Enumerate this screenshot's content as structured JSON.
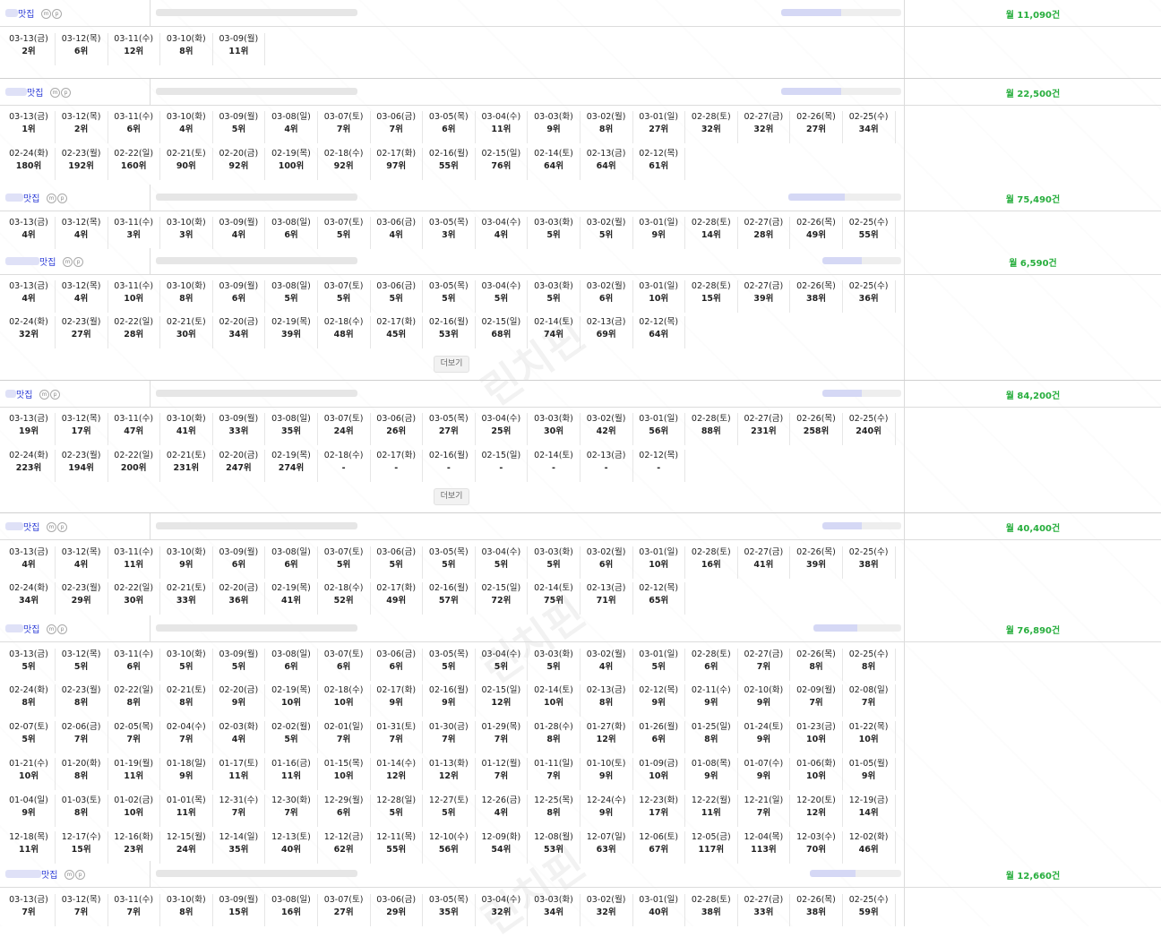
{
  "keyword_suffix": "맛집",
  "mp_badges": [
    "m",
    "p"
  ],
  "more_label": "더보기",
  "colors": {
    "name": "#2b3bd6",
    "volume": "#27ae3d"
  },
  "rows": [
    {
      "volume": "월 11,090건",
      "groups": [
        {
          "dates": [
            "03-13(금)",
            "03-12(목)",
            "03-11(수)",
            "03-10(화)",
            "03-09(월)"
          ],
          "ranks": [
            "2위",
            "6위",
            "12위",
            "8위",
            "11위"
          ]
        }
      ]
    },
    {
      "volume": "월 22,500건",
      "groups": [
        {
          "dates": [
            "03-13(금)",
            "03-12(목)",
            "03-11(수)",
            "03-10(화)",
            "03-09(월)",
            "03-08(일)",
            "03-07(토)",
            "03-06(금)",
            "03-05(목)",
            "03-04(수)",
            "03-03(화)",
            "03-02(월)",
            "03-01(일)",
            "02-28(토)",
            "02-27(금)",
            "02-26(목)",
            "02-25(수)"
          ],
          "ranks": [
            "1위",
            "2위",
            "6위",
            "4위",
            "5위",
            "4위",
            "7위",
            "7위",
            "6위",
            "11위",
            "9위",
            "8위",
            "27위",
            "32위",
            "32위",
            "27위",
            "34위"
          ]
        },
        {
          "dates": [
            "02-24(화)",
            "02-23(월)",
            "02-22(일)",
            "02-21(토)",
            "02-20(금)",
            "02-19(목)",
            "02-18(수)",
            "02-17(화)",
            "02-16(월)",
            "02-15(일)",
            "02-14(토)",
            "02-13(금)",
            "02-12(목)"
          ],
          "ranks": [
            "180위",
            "192위",
            "160위",
            "90위",
            "92위",
            "100위",
            "92위",
            "97위",
            "55위",
            "76위",
            "64위",
            "64위",
            "61위"
          ]
        }
      ]
    },
    {
      "volume": "월 75,490건",
      "groups": [
        {
          "dates": [
            "03-13(금)",
            "03-12(목)",
            "03-11(수)",
            "03-10(화)",
            "03-09(월)",
            "03-08(일)",
            "03-07(토)",
            "03-06(금)",
            "03-05(목)",
            "03-04(수)",
            "03-03(화)",
            "03-02(월)",
            "03-01(일)",
            "02-28(토)",
            "02-27(금)",
            "02-26(목)",
            "02-25(수)"
          ],
          "ranks": [
            "4위",
            "4위",
            "3위",
            "3위",
            "4위",
            "6위",
            "5위",
            "4위",
            "3위",
            "4위",
            "5위",
            "5위",
            "9위",
            "14위",
            "28위",
            "49위",
            "55위"
          ]
        }
      ]
    },
    {
      "volume": "월 6,590건",
      "groups": [
        {
          "dates": [
            "03-13(금)",
            "03-12(목)",
            "03-11(수)",
            "03-10(화)",
            "03-09(월)",
            "03-08(일)",
            "03-07(토)",
            "03-06(금)",
            "03-05(목)",
            "03-04(수)",
            "03-03(화)",
            "03-02(월)",
            "03-01(일)",
            "02-28(토)",
            "02-27(금)",
            "02-26(목)",
            "02-25(수)"
          ],
          "ranks": [
            "4위",
            "4위",
            "10위",
            "8위",
            "6위",
            "5위",
            "5위",
            "5위",
            "5위",
            "5위",
            "5위",
            "6위",
            "10위",
            "15위",
            "39위",
            "38위",
            "36위"
          ]
        },
        {
          "dates": [
            "02-24(화)",
            "02-23(월)",
            "02-22(일)",
            "02-21(토)",
            "02-20(금)",
            "02-19(목)",
            "02-18(수)",
            "02-17(화)",
            "02-16(월)",
            "02-15(일)",
            "02-14(토)",
            "02-13(금)",
            "02-12(목)"
          ],
          "ranks": [
            "32위",
            "27위",
            "28위",
            "30위",
            "34위",
            "39위",
            "48위",
            "45위",
            "53위",
            "68위",
            "74위",
            "69위",
            "64위"
          ]
        }
      ]
    },
    {
      "volume": "월 84,200건",
      "groups": [
        {
          "dates": [
            "03-13(금)",
            "03-12(목)",
            "03-11(수)",
            "03-10(화)",
            "03-09(월)",
            "03-08(일)",
            "03-07(토)",
            "03-06(금)",
            "03-05(목)",
            "03-04(수)",
            "03-03(화)",
            "03-02(월)",
            "03-01(일)",
            "02-28(토)",
            "02-27(금)",
            "02-26(목)",
            "02-25(수)"
          ],
          "ranks": [
            "19위",
            "17위",
            "47위",
            "41위",
            "33위",
            "35위",
            "24위",
            "26위",
            "27위",
            "25위",
            "30위",
            "42위",
            "56위",
            "88위",
            "231위",
            "258위",
            "240위"
          ]
        },
        {
          "dates": [
            "02-24(화)",
            "02-23(월)",
            "02-22(일)",
            "02-21(토)",
            "02-20(금)",
            "02-19(목)",
            "02-18(수)",
            "02-17(화)",
            "02-16(월)",
            "02-15(일)",
            "02-14(토)",
            "02-13(금)",
            "02-12(목)"
          ],
          "ranks": [
            "223위",
            "194위",
            "200위",
            "231위",
            "247위",
            "274위",
            "-",
            "-",
            "-",
            "-",
            "-",
            "-",
            "-"
          ]
        }
      ]
    },
    {
      "volume": "월 40,400건",
      "groups": [
        {
          "dates": [
            "03-13(금)",
            "03-12(목)",
            "03-11(수)",
            "03-10(화)",
            "03-09(월)",
            "03-08(일)",
            "03-07(토)",
            "03-06(금)",
            "03-05(목)",
            "03-04(수)",
            "03-03(화)",
            "03-02(월)",
            "03-01(일)",
            "02-28(토)",
            "02-27(금)",
            "02-26(목)",
            "02-25(수)"
          ],
          "ranks": [
            "4위",
            "4위",
            "11위",
            "9위",
            "6위",
            "6위",
            "5위",
            "5위",
            "5위",
            "5위",
            "5위",
            "6위",
            "10위",
            "16위",
            "41위",
            "39위",
            "38위"
          ]
        },
        {
          "dates": [
            "02-24(화)",
            "02-23(월)",
            "02-22(일)",
            "02-21(토)",
            "02-20(금)",
            "02-19(목)",
            "02-18(수)",
            "02-17(화)",
            "02-16(월)",
            "02-15(일)",
            "02-14(토)",
            "02-13(금)",
            "02-12(목)"
          ],
          "ranks": [
            "34위",
            "29위",
            "30위",
            "33위",
            "36위",
            "41위",
            "52위",
            "49위",
            "57위",
            "72위",
            "75위",
            "71위",
            "65위"
          ]
        }
      ]
    },
    {
      "volume": "월 76,890건",
      "groups": [
        {
          "dates": [
            "03-13(금)",
            "03-12(목)",
            "03-11(수)",
            "03-10(화)",
            "03-09(월)",
            "03-08(일)",
            "03-07(토)",
            "03-06(금)",
            "03-05(목)",
            "03-04(수)",
            "03-03(화)",
            "03-02(월)",
            "03-01(일)",
            "02-28(토)",
            "02-27(금)",
            "02-26(목)",
            "02-25(수)"
          ],
          "ranks": [
            "5위",
            "5위",
            "6위",
            "5위",
            "5위",
            "6위",
            "6위",
            "6위",
            "5위",
            "5위",
            "5위",
            "4위",
            "5위",
            "6위",
            "7위",
            "8위",
            "8위"
          ]
        },
        {
          "dates": [
            "02-24(화)",
            "02-23(월)",
            "02-22(일)",
            "02-21(토)",
            "02-20(금)",
            "02-19(목)",
            "02-18(수)",
            "02-17(화)",
            "02-16(월)",
            "02-15(일)",
            "02-14(토)",
            "02-13(금)",
            "02-12(목)",
            "02-11(수)",
            "02-10(화)",
            "02-09(월)",
            "02-08(일)"
          ],
          "ranks": [
            "8위",
            "8위",
            "8위",
            "8위",
            "9위",
            "10위",
            "10위",
            "9위",
            "9위",
            "12위",
            "10위",
            "8위",
            "9위",
            "9위",
            "9위",
            "7위",
            "7위"
          ]
        },
        {
          "dates": [
            "02-07(토)",
            "02-06(금)",
            "02-05(목)",
            "02-04(수)",
            "02-03(화)",
            "02-02(월)",
            "02-01(일)",
            "01-31(토)",
            "01-30(금)",
            "01-29(목)",
            "01-28(수)",
            "01-27(화)",
            "01-26(월)",
            "01-25(일)",
            "01-24(토)",
            "01-23(금)",
            "01-22(목)"
          ],
          "ranks": [
            "5위",
            "7위",
            "7위",
            "7위",
            "4위",
            "5위",
            "7위",
            "7위",
            "7위",
            "7위",
            "8위",
            "12위",
            "6위",
            "8위",
            "9위",
            "10위",
            "10위"
          ]
        },
        {
          "dates": [
            "01-21(수)",
            "01-20(화)",
            "01-19(월)",
            "01-18(일)",
            "01-17(토)",
            "01-16(금)",
            "01-15(목)",
            "01-14(수)",
            "01-13(화)",
            "01-12(월)",
            "01-11(일)",
            "01-10(토)",
            "01-09(금)",
            "01-08(목)",
            "01-07(수)",
            "01-06(화)",
            "01-05(월)"
          ],
          "ranks": [
            "10위",
            "8위",
            "11위",
            "9위",
            "11위",
            "11위",
            "10위",
            "12위",
            "12위",
            "7위",
            "7위",
            "9위",
            "10위",
            "9위",
            "9위",
            "10위",
            "9위"
          ]
        },
        {
          "dates": [
            "01-04(일)",
            "01-03(토)",
            "01-02(금)",
            "01-01(목)",
            "12-31(수)",
            "12-30(화)",
            "12-29(월)",
            "12-28(일)",
            "12-27(토)",
            "12-26(금)",
            "12-25(목)",
            "12-24(수)",
            "12-23(화)",
            "12-22(월)",
            "12-21(일)",
            "12-20(토)",
            "12-19(금)"
          ],
          "ranks": [
            "9위",
            "8위",
            "10위",
            "11위",
            "7위",
            "7위",
            "6위",
            "5위",
            "5위",
            "4위",
            "8위",
            "9위",
            "17위",
            "11위",
            "7위",
            "12위",
            "14위"
          ]
        },
        {
          "dates": [
            "12-18(목)",
            "12-17(수)",
            "12-16(화)",
            "12-15(월)",
            "12-14(일)",
            "12-13(토)",
            "12-12(금)",
            "12-11(목)",
            "12-10(수)",
            "12-09(화)",
            "12-08(월)",
            "12-07(일)",
            "12-06(토)",
            "12-05(금)",
            "12-04(목)",
            "12-03(수)",
            "12-02(화)"
          ],
          "ranks": [
            "11위",
            "15위",
            "23위",
            "24위",
            "35위",
            "40위",
            "62위",
            "55위",
            "56위",
            "54위",
            "53위",
            "63위",
            "67위",
            "117위",
            "113위",
            "70위",
            "46위"
          ]
        }
      ]
    },
    {
      "volume": "월 12,660건",
      "groups": [
        {
          "dates": [
            "03-13(금)",
            "03-12(목)",
            "03-11(수)",
            "03-10(화)",
            "03-09(월)",
            "03-08(일)",
            "03-07(토)",
            "03-06(금)",
            "03-05(목)",
            "03-04(수)",
            "03-03(화)",
            "03-02(월)",
            "03-01(일)",
            "02-28(토)",
            "02-27(금)",
            "02-26(목)",
            "02-25(수)"
          ],
          "ranks": [
            "7위",
            "7위",
            "7위",
            "8위",
            "15위",
            "16위",
            "27위",
            "29위",
            "35위",
            "32위",
            "34위",
            "32위",
            "40위",
            "38위",
            "33위",
            "38위",
            "59위"
          ]
        }
      ]
    }
  ]
}
